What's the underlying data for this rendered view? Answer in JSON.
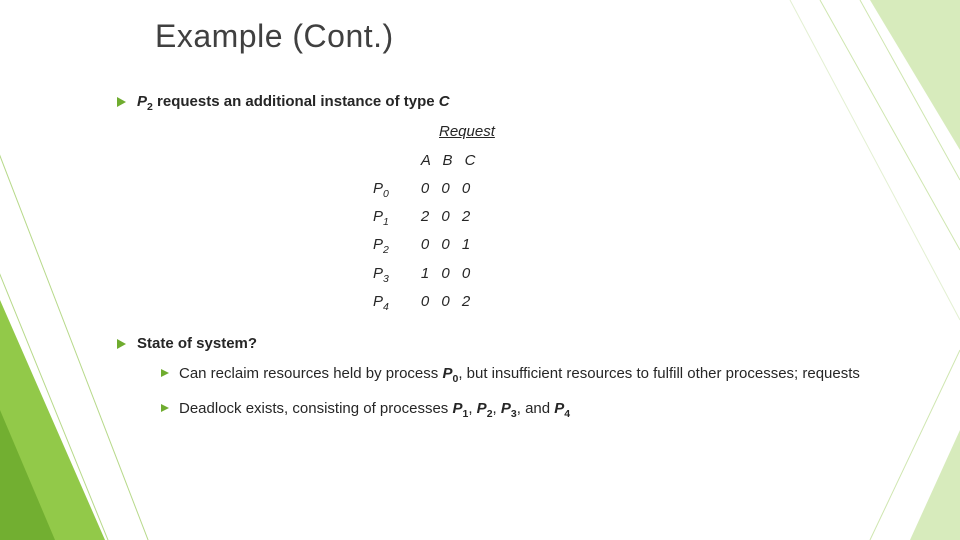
{
  "title": "Example (Cont.)",
  "bullet1_prefix": "P",
  "bullet1_sub": "2",
  "bullet1_rest": " requests an additional instance of type ",
  "bullet1_tail": "C",
  "table": {
    "header": "Request",
    "cols": "A B C",
    "rows": [
      {
        "p": "P",
        "s": "0",
        "v": "0 0 0"
      },
      {
        "p": "P",
        "s": "1",
        "v": "2 0 2"
      },
      {
        "p": "P",
        "s": "2",
        "v": "0 0 1"
      },
      {
        "p": "P",
        "s": "3",
        "v": "1 0 0"
      },
      {
        "p": "P",
        "s": "4",
        "v": "0 0 2"
      }
    ]
  },
  "bullet2": "State of system?",
  "sub1_a": "Can reclaim resources held by process ",
  "sub1_pb": "P",
  "sub1_ps": "0",
  "sub1_b": ", but insufficient resources to fulfill other processes; requests",
  "sub2_a": "Deadlock exists, consisting of processes ",
  "sub2_p1b": "P",
  "sub2_p1s": "1",
  "sub2_c1": ", ",
  "sub2_p2b": "P",
  "sub2_p2s": "2",
  "sub2_c2": ", ",
  "sub2_p3b": "P",
  "sub2_p3s": "3",
  "sub2_c3": ", and ",
  "sub2_p4b": "P",
  "sub2_p4s": "4",
  "chart_data": {
    "type": "table",
    "title": "Request",
    "columns": [
      "A",
      "B",
      "C"
    ],
    "rows": [
      {
        "process": "P0",
        "A": 0,
        "B": 0,
        "C": 0
      },
      {
        "process": "P1",
        "A": 2,
        "B": 0,
        "C": 2
      },
      {
        "process": "P2",
        "A": 0,
        "B": 0,
        "C": 1
      },
      {
        "process": "P3",
        "A": 1,
        "B": 0,
        "C": 0
      },
      {
        "process": "P4",
        "A": 0,
        "B": 0,
        "C": 2
      }
    ]
  }
}
